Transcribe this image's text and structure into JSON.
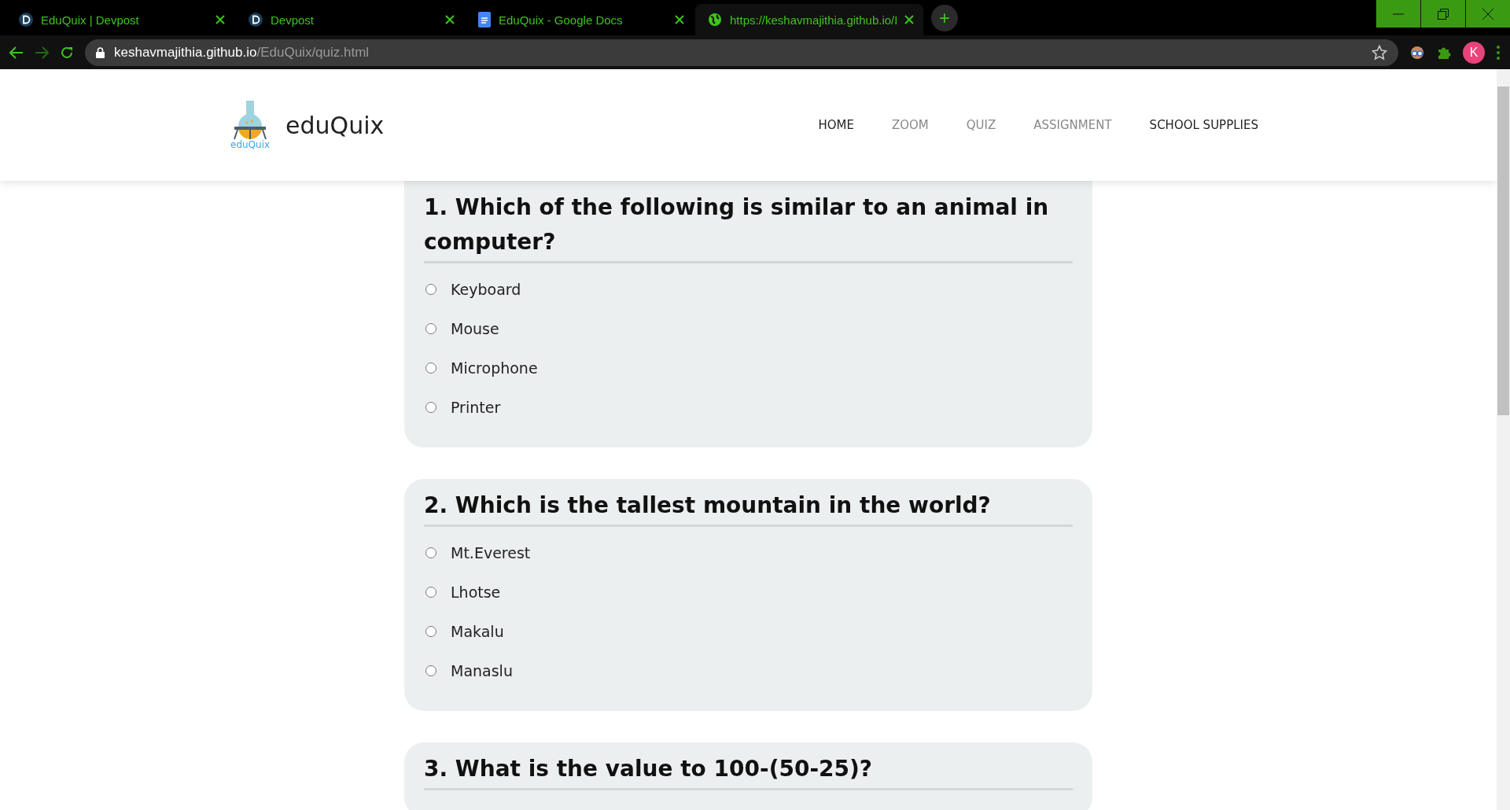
{
  "browser": {
    "tabs": [
      {
        "title": "EduQuix | Devpost",
        "kind": "d",
        "selected": false
      },
      {
        "title": "Devpost",
        "kind": "d",
        "selected": false
      },
      {
        "title": "EduQuix - Google Docs",
        "kind": "docs",
        "selected": false
      },
      {
        "title": "https://keshavmajithia.github.io/I",
        "kind": "globe",
        "selected": true
      }
    ],
    "new_tab": "+",
    "address": {
      "host": "keshavmajithia.github.io",
      "path": "/EduQuix/quiz.html"
    },
    "profile": "K"
  },
  "header": {
    "logo_text": "eduQuix",
    "title": "eduQuix",
    "nav": [
      {
        "label": "HOME",
        "highlighted": true
      },
      {
        "label": "ZOOM",
        "highlighted": false
      },
      {
        "label": "QUIZ",
        "highlighted": false
      },
      {
        "label": "ASSIGNMENT",
        "highlighted": false
      },
      {
        "label": "SCHOOL SUPPLIES",
        "highlighted": true
      }
    ]
  },
  "questions": [
    {
      "question": "1. Which of the following is similar to an animal in computer?",
      "options": [
        {
          "label": "Keyboard",
          "selected": false
        },
        {
          "label": "Mouse",
          "selected": false
        },
        {
          "label": "Microphone",
          "selected": false
        },
        {
          "label": "Printer",
          "selected": false
        }
      ]
    },
    {
      "question": "2. Which is the tallest mountain in the world?",
      "options": [
        {
          "label": "Mt.Everest",
          "selected": false
        },
        {
          "label": "Lhotse",
          "selected": false
        },
        {
          "label": "Makalu",
          "selected": false
        },
        {
          "label": "Manaslu",
          "selected": false
        }
      ]
    },
    {
      "question": "3. What is the value to 100-(50-25)?"
    }
  ]
}
